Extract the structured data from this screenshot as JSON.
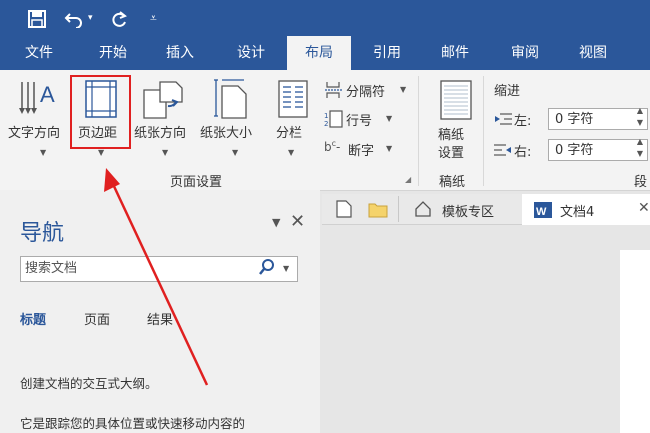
{
  "quick_access": {
    "save_icon": "save-icon",
    "undo_icon": "undo-icon",
    "redo_icon": "redo-icon",
    "customize_icon": "customize-icon"
  },
  "tabs": [
    {
      "label": "文件"
    },
    {
      "label": "开始"
    },
    {
      "label": "插入"
    },
    {
      "label": "设计"
    },
    {
      "label": "布局",
      "active": true
    },
    {
      "label": "引用"
    },
    {
      "label": "邮件"
    },
    {
      "label": "审阅"
    },
    {
      "label": "视图"
    }
  ],
  "ribbon": {
    "page_setup": {
      "text_direction": "文字方向",
      "margins": "页边距",
      "orientation": "纸张方向",
      "size": "纸张大小",
      "columns": "分栏",
      "breaks": "分隔符",
      "line_numbers": "行号",
      "hyphenation": "断字",
      "group_label": "页面设置"
    },
    "draft": {
      "label_line1": "稿纸",
      "label_line2": "设置",
      "group_label": "稿纸"
    },
    "indent": {
      "header": "缩进",
      "left_label": "左:",
      "left_value": "0 字符",
      "right_label": "右:",
      "right_value": "0 字符"
    },
    "spacing": {
      "group_label_partial": "段"
    }
  },
  "nav_pane": {
    "title": "导航",
    "search_placeholder": "搜索文档",
    "tabs": [
      {
        "label": "标题",
        "active": true
      },
      {
        "label": "页面"
      },
      {
        "label": "结果"
      }
    ],
    "body_line1": "创建文档的交互式大纲。",
    "body_line2": "它是跟踪您的具体位置或快速移动内容的"
  },
  "doc_tabs": {
    "template_tab": "模板专区",
    "doc_tab": "文档4"
  },
  "colors": {
    "accent": "#2b579a",
    "highlight": "#e02020"
  }
}
